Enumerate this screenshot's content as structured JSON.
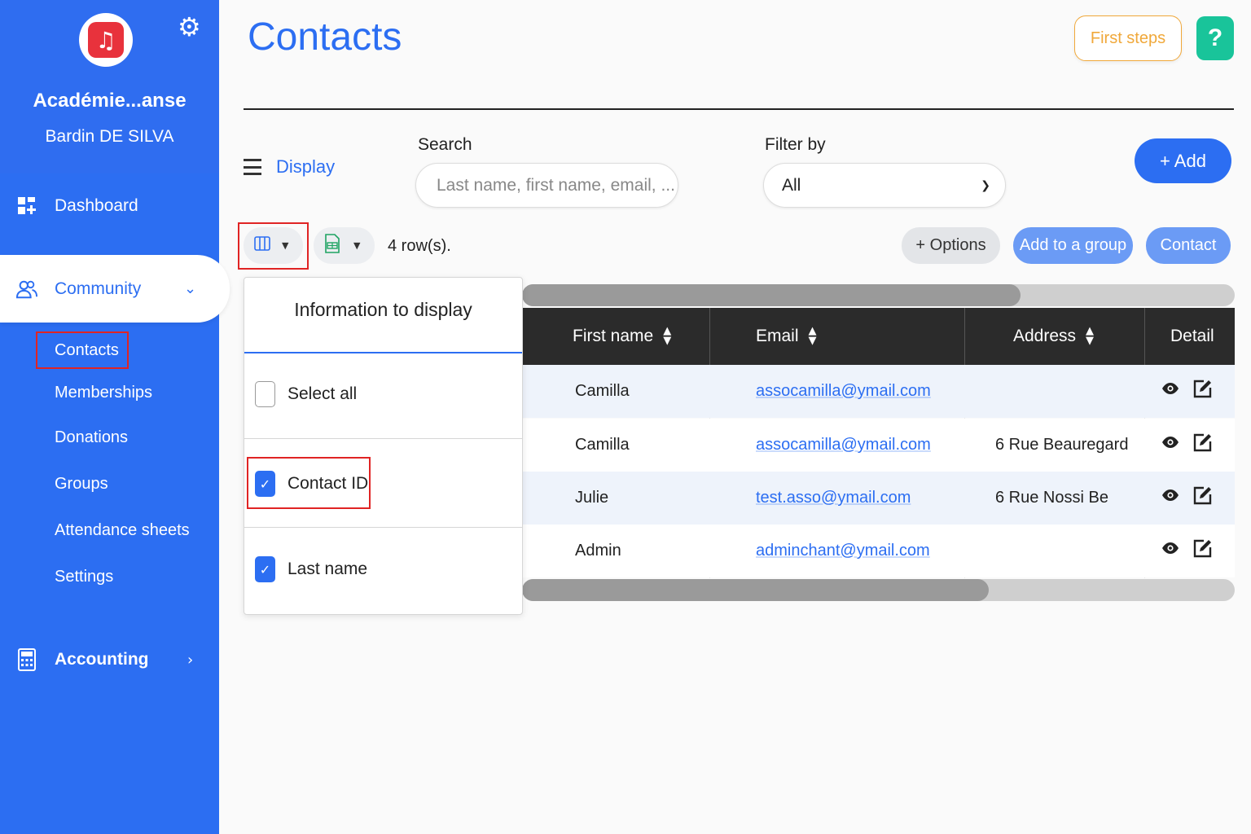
{
  "colors": {
    "accent": "#2c6ef2",
    "sidebar": "#2c6ef2",
    "first_steps": "#f0a83a",
    "help": "#19c49a",
    "table_header": "#2b2b2b",
    "highlight": "#e02424"
  },
  "sidebar": {
    "logo_icon": "music-note-icon",
    "org_name": "Académie...anse",
    "user_name": "Bardin DE SILVA",
    "items": [
      {
        "label": "Dashboard",
        "icon": "dashboard-icon"
      },
      {
        "label": "Community",
        "icon": "community-icon"
      },
      {
        "label": "Accounting",
        "icon": "calculator-icon"
      }
    ],
    "community_sub": [
      "Contacts",
      "Memberships",
      "Donations",
      "Groups",
      "Attendance sheets",
      "Settings"
    ]
  },
  "header": {
    "title": "Contacts",
    "first_steps": "First steps",
    "help": "?"
  },
  "toolbar": {
    "display_label": "Display",
    "search_label": "Search",
    "search_placeholder": "Last name, first name, email, ...",
    "filter_label": "Filter by",
    "filter_value": "All",
    "add_label": "+ Add",
    "rows_count": "4 row(s).",
    "options_label": "+ Options",
    "add_to_group_label": "Add to a group",
    "contact_label": "Contact"
  },
  "table": {
    "columns": [
      "First name",
      "Email",
      "Address",
      "Detail"
    ],
    "rows": [
      {
        "first_name": "Camilla",
        "email": "assocamilla@ymail.com",
        "address": ""
      },
      {
        "first_name": "Camilla",
        "email": "assocamilla@ymail.com",
        "address": "6 Rue Beauregard"
      },
      {
        "first_name": "Julie",
        "email": "test.asso@ymail.com",
        "address": "6 Rue Nossi Be"
      },
      {
        "first_name": "Admin",
        "email": "adminchant@ymail.com",
        "address": ""
      }
    ]
  },
  "columns_panel": {
    "title": "Information to display",
    "options": [
      {
        "label": "Select all",
        "checked": false
      },
      {
        "label": "Contact ID",
        "checked": true
      },
      {
        "label": "Last name",
        "checked": true
      }
    ]
  }
}
